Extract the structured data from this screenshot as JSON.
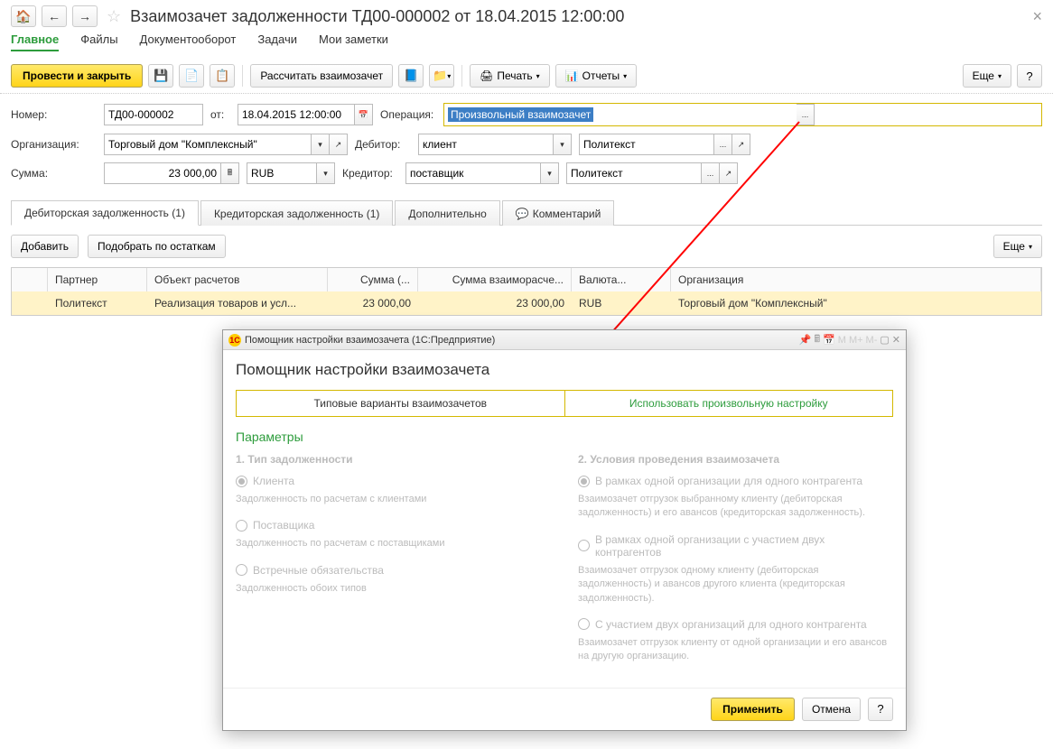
{
  "header": {
    "title": "Взаимозачет задолженности ТД00-000002 от 18.04.2015 12:00:00"
  },
  "navTabs": {
    "main": "Главное",
    "files": "Файлы",
    "docflow": "Документооборот",
    "tasks": "Задачи",
    "notes": "Мои заметки"
  },
  "toolbar": {
    "post_close": "Провести и закрыть",
    "calc": "Рассчитать взаимозачет",
    "print": "Печать",
    "reports": "Отчеты",
    "more": "Еще"
  },
  "form": {
    "number_label": "Номер:",
    "number_value": "ТД00-000002",
    "from_label": "от:",
    "date_value": "18.04.2015 12:00:00",
    "operation_label": "Операция:",
    "operation_value": "Произвольный взаимозачет",
    "org_label": "Организация:",
    "org_value": "Торговый дом \"Комплексный\"",
    "debtor_label": "Дебитор:",
    "debtor_type": "клиент",
    "debtor_value": "Политекст",
    "creditor_label": "Кредитор:",
    "creditor_type": "поставщик",
    "creditor_value": "Политекст",
    "sum_label": "Сумма:",
    "sum_value": "23 000,00",
    "currency": "RUB"
  },
  "subtabs": {
    "debtor_debt": "Дебиторская задолженность (1)",
    "creditor_debt": "Кредиторская задолженность (1)",
    "additional": "Дополнительно",
    "comment": "Комментарий"
  },
  "actions": {
    "add": "Добавить",
    "pick": "Подобрать по остаткам",
    "more": "Еще"
  },
  "table": {
    "headers": {
      "partner": "Партнер",
      "object": "Объект расчетов",
      "sum": "Сумма (...",
      "sum_offset": "Сумма взаиморасче...",
      "currency": "Валюта...",
      "org": "Организация"
    },
    "rows": [
      {
        "partner": "Политекст",
        "object": "Реализация товаров и усл...",
        "sum": "23 000,00",
        "sum_offset": "23 000,00",
        "currency": "RUB",
        "org": "Торговый дом \"Комплексный\""
      }
    ]
  },
  "dialog": {
    "window_title": "Помощник настройки взаимозачета  (1С:Предприятие)",
    "heading": "Помощник настройки взаимозачета",
    "tab1": "Типовые варианты взаимозачетов",
    "tab2": "Использовать произвольную настройку",
    "params_title": "Параметры",
    "sect1": "1. Тип задолженности",
    "opt_client": "Клиента",
    "desc_client": "Задолженность по расчетам с клиентами",
    "opt_supplier": "Поставщика",
    "desc_supplier": "Задолженность по расчетам с поставщиками",
    "opt_mutual": "Встречные обязательства",
    "desc_mutual": "Задолженность обоих типов",
    "sect2": "2. Условия проведения взаимозачета",
    "opt_c1": "В рамках одной организации для одного контрагента",
    "desc_c1": "Взаимозачет отгрузок выбранному клиенту (дебиторская задолженность) и его авансов (кредиторская задолженность).",
    "opt_c2": "В рамках одной организации с участием двух контрагентов",
    "desc_c2": "Взаимозачет отгрузок одному клиенту (дебиторская задолженность) и авансов другого клиента (кредиторская задолженность).",
    "opt_c3": "С участием двух организаций для одного контрагента",
    "desc_c3": "Взаимозачет отгрузок клиенту от одной организации и его авансов на другую организацию.",
    "apply": "Применить",
    "cancel": "Отмена"
  }
}
